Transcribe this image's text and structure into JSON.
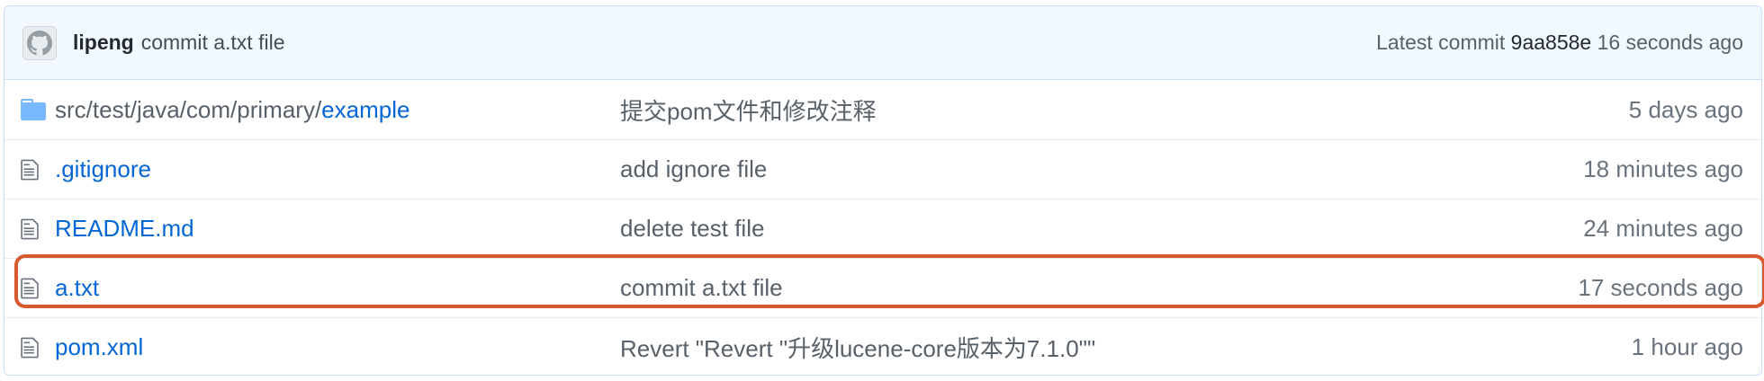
{
  "commit_bar": {
    "avatar_icon": "octocat-avatar-icon",
    "author": "lipeng",
    "message": "commit a.txt file",
    "latest_label": "Latest commit",
    "sha": "9aa858e",
    "age": "16 seconds ago"
  },
  "files": [
    {
      "icon": "folder-icon",
      "dir_prefix": "src/test/java/com/primary/",
      "name": "example",
      "message": "提交pom文件和修改注释",
      "age": "5 days ago"
    },
    {
      "icon": "file-icon",
      "dir_prefix": "",
      "name": ".gitignore",
      "message": "add ignore file",
      "age": "18 minutes ago"
    },
    {
      "icon": "file-icon",
      "dir_prefix": "",
      "name": "README.md",
      "message": "delete test file",
      "age": "24 minutes ago"
    },
    {
      "icon": "file-icon",
      "dir_prefix": "",
      "name": "a.txt",
      "message": "commit a.txt file",
      "age": "17 seconds ago"
    },
    {
      "icon": "file-icon",
      "dir_prefix": "",
      "name": "pom.xml",
      "message": "Revert \"Revert \"升级lucene-core版本为7.1.0\"\"",
      "age": "1 hour ago"
    }
  ],
  "colors": {
    "link": "#0366d6",
    "commit_bar_bg": "#f1f8ff",
    "highlight_border": "#d65a2c"
  }
}
